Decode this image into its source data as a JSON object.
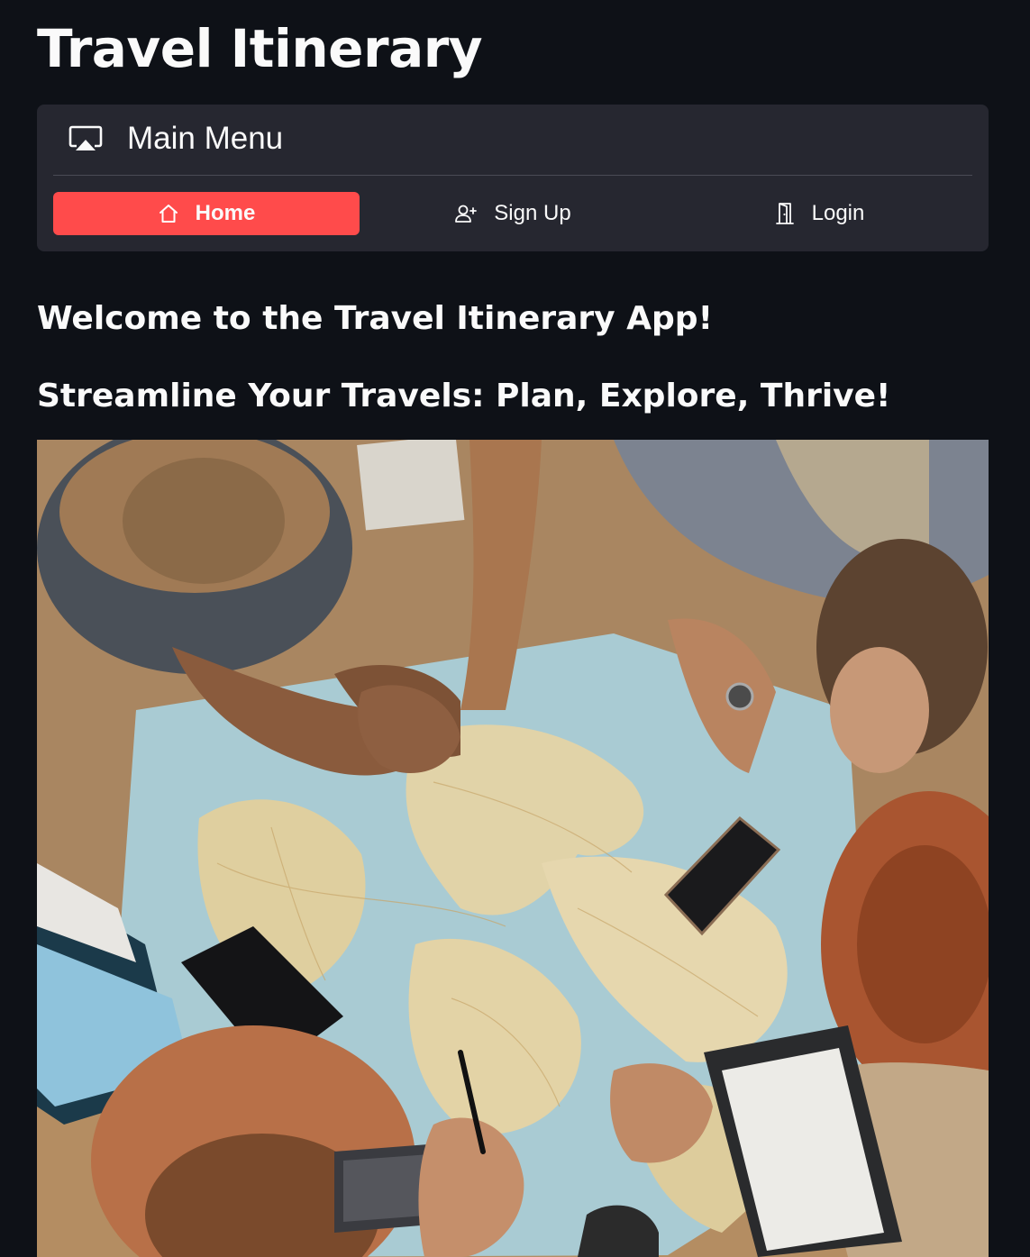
{
  "page": {
    "title": "Travel Itinerary"
  },
  "menu": {
    "title": "Main Menu",
    "header_icon": "airplay-icon",
    "items": [
      {
        "label": "Home",
        "icon": "home-icon",
        "active": true
      },
      {
        "label": "Sign Up",
        "icon": "person-add-icon",
        "active": false
      },
      {
        "label": "Login",
        "icon": "door-icon",
        "active": false
      }
    ]
  },
  "content": {
    "welcome": "Welcome to the Travel Itinerary App!",
    "tagline": "Streamline Your Travels: Plan, Explore, Thrive!"
  },
  "colors": {
    "background": "#0e1117",
    "card": "#262730",
    "accent": "#ff4b4b",
    "text": "#fafafa"
  }
}
